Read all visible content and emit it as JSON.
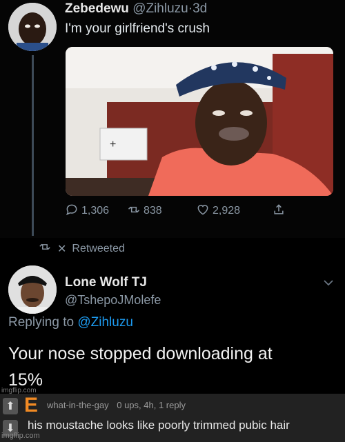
{
  "tweet1": {
    "name": "Zebedewu",
    "handle": "@Zihluzu",
    "separator": "·",
    "age": "3d",
    "text": "I'm your girlfriend's crush",
    "replies": "1,306",
    "retweets": "838",
    "likes": "2,928"
  },
  "retweet_notice": {
    "label": "Retweeted"
  },
  "tweet2": {
    "name": "Lone Wolf TJ",
    "handle": "@TshepoJMolefe",
    "replying_prefix": "Replying to",
    "replying_to": "@Zihluzu",
    "text_line1": "Your nose stopped downloading at",
    "text_line2": "15%"
  },
  "comment": {
    "badge": "E",
    "username": "what-in-the-gay",
    "meta": "0 ups, 4h, 1 reply",
    "text": "his moustache looks like poorly trimmed pubic hair"
  },
  "watermark_small": "imgflip.com",
  "watermark": "imgflip.com",
  "colors": {
    "background": "#000000",
    "link_blue": "#1d9bf0",
    "muted_gray": "#8b98a5",
    "badge_orange": "#f08a24",
    "comment_bg": "#222222"
  },
  "icons": [
    "reply-icon",
    "retweet-icon",
    "like-icon",
    "share-icon",
    "close-x-icon",
    "chevron-down-icon",
    "upvote-icon",
    "downvote-icon"
  ]
}
